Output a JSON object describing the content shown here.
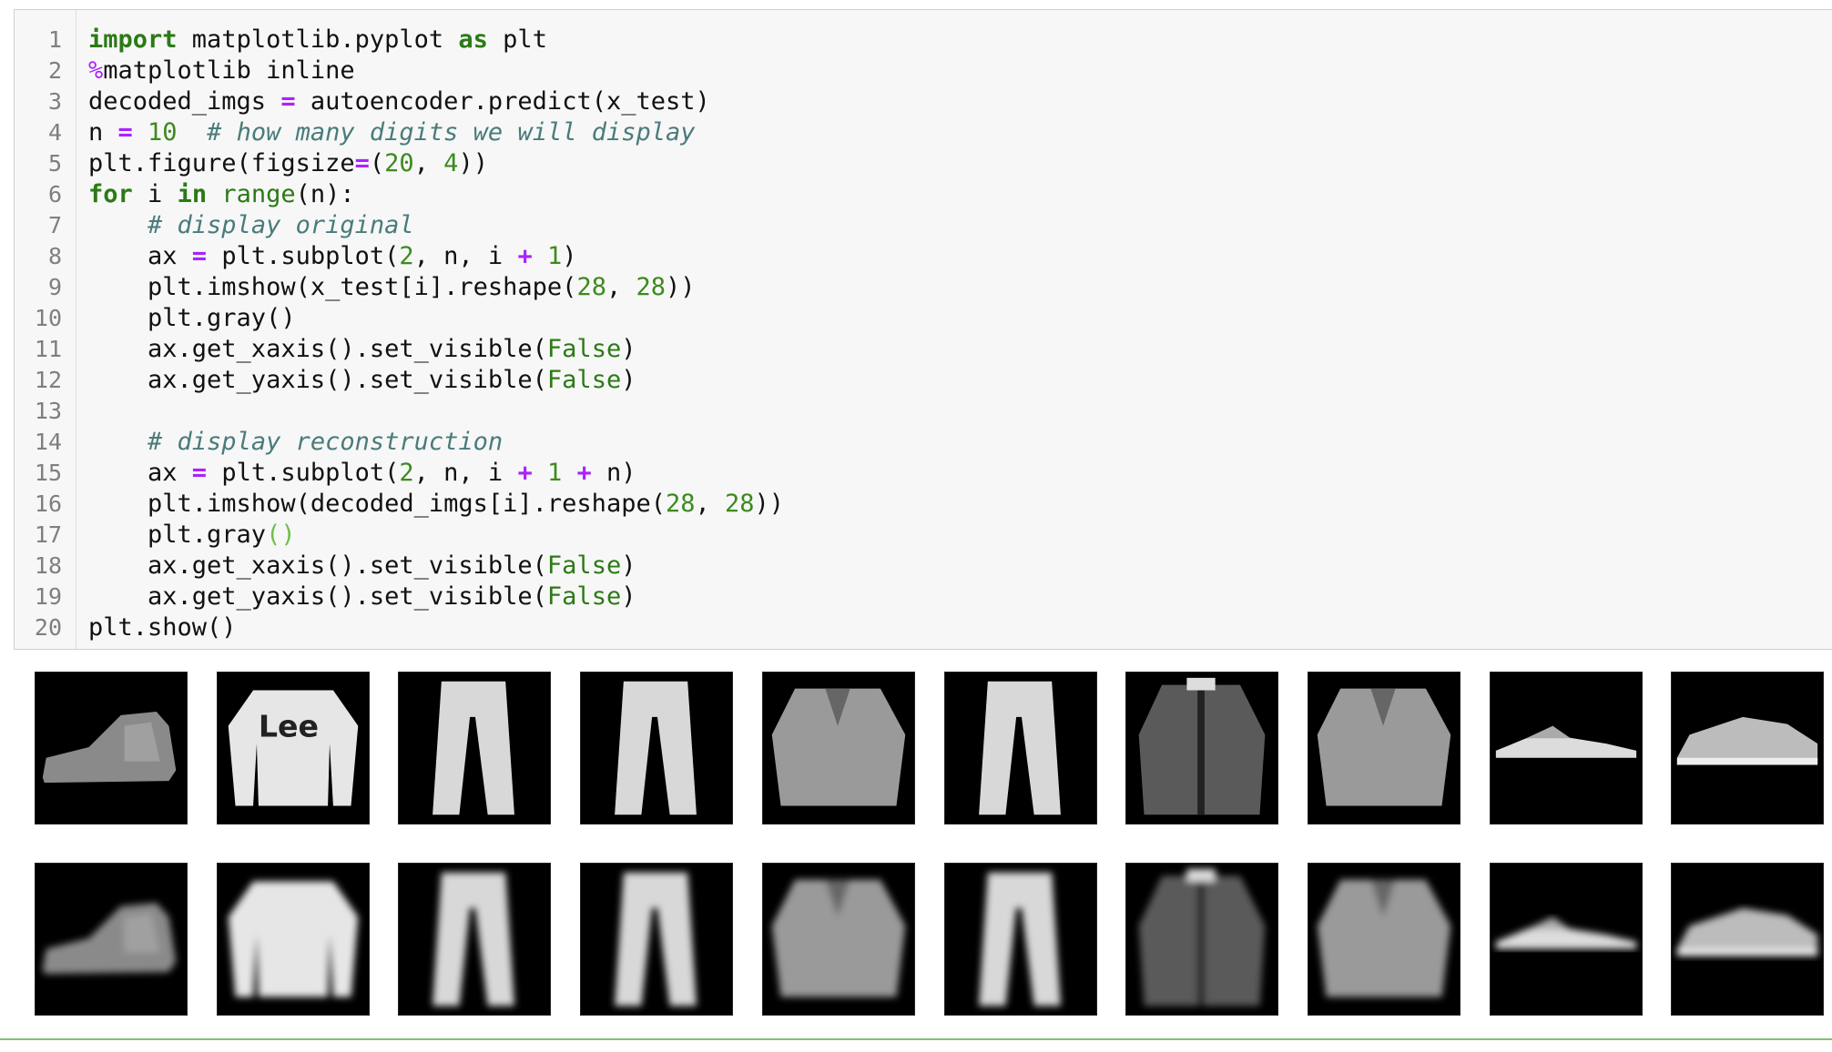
{
  "code_cell": {
    "line_numbers": [
      "1",
      "2",
      "3",
      "4",
      "5",
      "6",
      "7",
      "8",
      "9",
      "10",
      "11",
      "12",
      "13",
      "14",
      "15",
      "16",
      "17",
      "18",
      "19",
      "20"
    ],
    "lines": [
      [
        [
          "kw",
          "import"
        ],
        [
          "plain",
          " matplotlib.pyplot "
        ],
        [
          "kw",
          "as"
        ],
        [
          "plain",
          " plt"
        ]
      ],
      [
        [
          "magic",
          "%"
        ],
        [
          "plain",
          "matplotlib inline"
        ]
      ],
      [
        [
          "plain",
          "decoded_imgs "
        ],
        [
          "op",
          "="
        ],
        [
          "plain",
          " autoencoder.predict(x_test)"
        ]
      ],
      [
        [
          "plain",
          "n "
        ],
        [
          "op",
          "="
        ],
        [
          "plain",
          " "
        ],
        [
          "num",
          "10"
        ],
        [
          "plain",
          "  "
        ],
        [
          "com",
          "# how many digits we will display"
        ]
      ],
      [
        [
          "plain",
          "plt.figure(figsize"
        ],
        [
          "op",
          "="
        ],
        [
          "plain",
          "("
        ],
        [
          "num",
          "20"
        ],
        [
          "plain",
          ", "
        ],
        [
          "num",
          "4"
        ],
        [
          "plain",
          "))"
        ]
      ],
      [
        [
          "kw",
          "for"
        ],
        [
          "plain",
          " i "
        ],
        [
          "kw",
          "in"
        ],
        [
          "plain",
          " "
        ],
        [
          "bi",
          "range"
        ],
        [
          "plain",
          "(n):"
        ]
      ],
      [
        [
          "plain",
          "    "
        ],
        [
          "com",
          "# display original"
        ]
      ],
      [
        [
          "plain",
          "    ax "
        ],
        [
          "op",
          "="
        ],
        [
          "plain",
          " plt.subplot("
        ],
        [
          "num",
          "2"
        ],
        [
          "plain",
          ", n, i "
        ],
        [
          "op",
          "+"
        ],
        [
          "plain",
          " "
        ],
        [
          "num",
          "1"
        ],
        [
          "plain",
          ")"
        ]
      ],
      [
        [
          "plain",
          "    plt.imshow(x_test[i].reshape("
        ],
        [
          "num",
          "28"
        ],
        [
          "plain",
          ", "
        ],
        [
          "num",
          "28"
        ],
        [
          "plain",
          "))"
        ]
      ],
      [
        [
          "plain",
          "    plt.gray()"
        ]
      ],
      [
        [
          "plain",
          "    ax.get_xaxis().set_visible("
        ],
        [
          "const",
          "False"
        ],
        [
          "plain",
          ")"
        ]
      ],
      [
        [
          "plain",
          "    ax.get_yaxis().set_visible("
        ],
        [
          "const",
          "False"
        ],
        [
          "plain",
          ")"
        ]
      ],
      [
        [
          "plain",
          " "
        ]
      ],
      [
        [
          "plain",
          "    "
        ],
        [
          "com",
          "# display reconstruction"
        ]
      ],
      [
        [
          "plain",
          "    ax "
        ],
        [
          "op",
          "="
        ],
        [
          "plain",
          " plt.subplot("
        ],
        [
          "num",
          "2"
        ],
        [
          "plain",
          ", n, i "
        ],
        [
          "op",
          "+"
        ],
        [
          "plain",
          " "
        ],
        [
          "num",
          "1"
        ],
        [
          "plain",
          " "
        ],
        [
          "op",
          "+"
        ],
        [
          "plain",
          " n)"
        ]
      ],
      [
        [
          "plain",
          "    plt.imshow(decoded_imgs[i].reshape("
        ],
        [
          "num",
          "28"
        ],
        [
          "plain",
          ", "
        ],
        [
          "num",
          "28"
        ],
        [
          "plain",
          "))"
        ]
      ],
      [
        [
          "plain",
          "    plt.gray"
        ],
        [
          "par",
          "()"
        ]
      ],
      [
        [
          "plain",
          "    ax.get_xaxis().set_visible("
        ],
        [
          "const",
          "False"
        ],
        [
          "plain",
          ")"
        ]
      ],
      [
        [
          "plain",
          "    ax.get_yaxis().set_visible("
        ],
        [
          "const",
          "False"
        ],
        [
          "plain",
          ")"
        ]
      ],
      [
        [
          "plain",
          "plt.show()"
        ]
      ]
    ]
  },
  "output": {
    "original_row": [
      "ankle-boot-image",
      "pullover-image",
      "trouser-image",
      "trouser-image",
      "shirt-image",
      "trouser-image",
      "coat-image",
      "shirt-image",
      "sandal-image",
      "sneaker-image"
    ],
    "reconstruction_row": [
      "ankle-boot-image",
      "pullover-image",
      "trouser-image",
      "trouser-image",
      "shirt-image",
      "trouser-image",
      "coat-image",
      "shirt-image",
      "sandal-image",
      "sneaker-image"
    ]
  }
}
